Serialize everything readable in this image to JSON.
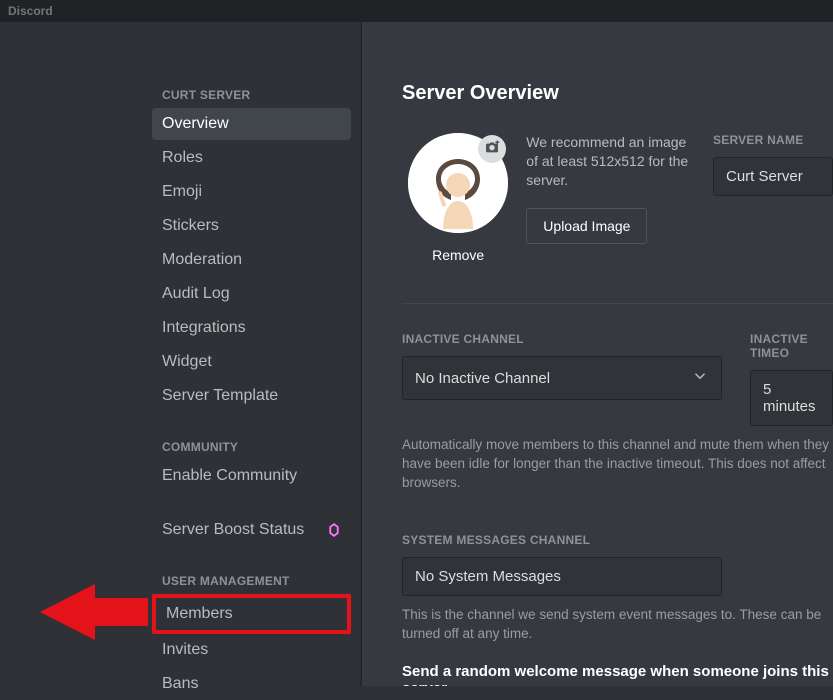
{
  "titlebar": {
    "label": "Discord"
  },
  "sidebar": {
    "catServer": "CURT SERVER",
    "items": [
      {
        "label": "Overview"
      },
      {
        "label": "Roles"
      },
      {
        "label": "Emoji"
      },
      {
        "label": "Stickers"
      },
      {
        "label": "Moderation"
      },
      {
        "label": "Audit Log"
      },
      {
        "label": "Integrations"
      },
      {
        "label": "Widget"
      },
      {
        "label": "Server Template"
      }
    ],
    "catCommunity": "COMMUNITY",
    "community": [
      {
        "label": "Enable Community"
      }
    ],
    "boost": {
      "label": "Server Boost Status"
    },
    "catUserMgmt": "USER MANAGEMENT",
    "userMgmt": [
      {
        "label": "Members"
      },
      {
        "label": "Invites"
      },
      {
        "label": "Bans"
      }
    ]
  },
  "main": {
    "title": "Server Overview",
    "iconHint": "We recommend an image of at least 512x512 for the server.",
    "uploadBtn": "Upload Image",
    "removeLink": "Remove",
    "serverName": {
      "label": "SERVER NAME",
      "value": "Curt Server"
    },
    "inactiveChannel": {
      "label": "INACTIVE CHANNEL",
      "value": "No Inactive Channel"
    },
    "inactiveTimeout": {
      "label": "INACTIVE TIMEO",
      "value": "5 minutes"
    },
    "inactiveHelp": "Automatically move members to this channel and mute them when they have been idle for longer than the inactive timeout. This does not affect browsers.",
    "sysMsg": {
      "label": "SYSTEM MESSAGES CHANNEL",
      "value": "No System Messages"
    },
    "sysHelp": "This is the channel we send system event messages to. These can be turned off at any time.",
    "welcomeHdr": "Send a random welcome message when someone joins this server."
  }
}
